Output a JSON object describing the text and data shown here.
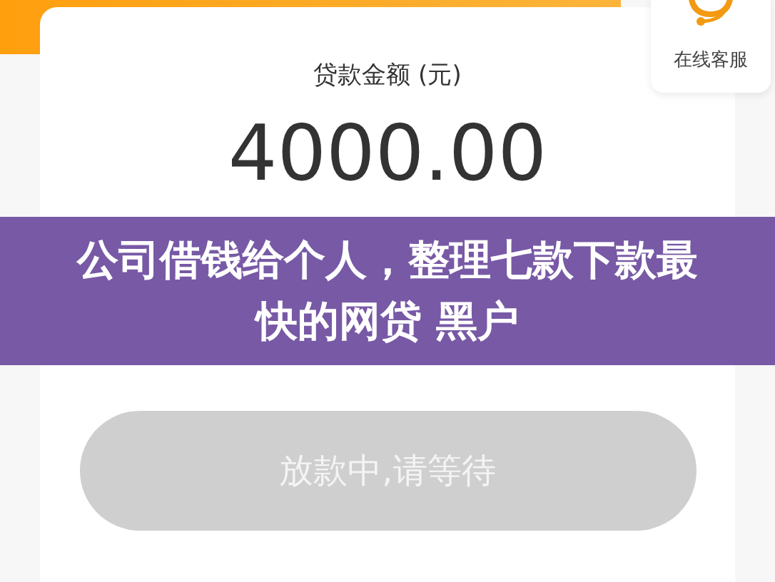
{
  "service": {
    "label": "在线客服"
  },
  "loan": {
    "label": "贷款金额 (元)",
    "amount": "4000.00"
  },
  "banner": {
    "title": "公司借钱给个人，整理七款下款最快的网贷 黑户"
  },
  "action_button": {
    "label": "放款中,请等待",
    "disabled": true
  }
}
